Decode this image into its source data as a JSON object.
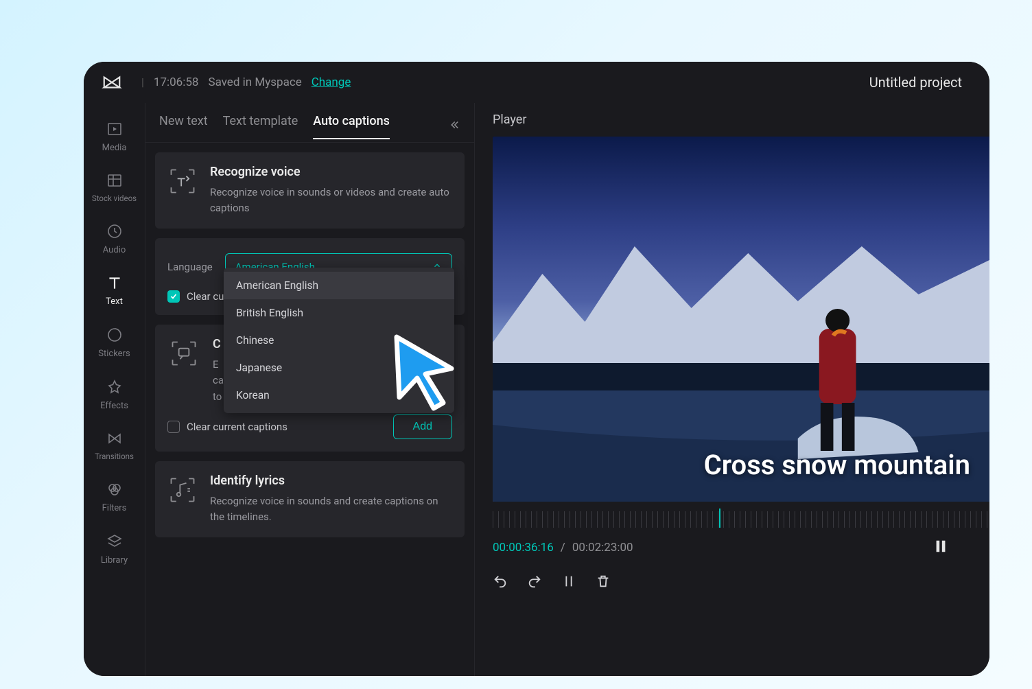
{
  "colors": {
    "accent": "#00c6b7",
    "bg_dark": "#1a1a1e",
    "card": "#26262b",
    "dropdown": "#2e2e33"
  },
  "header": {
    "time": "17:06:58",
    "saved_label": "Saved in Myspace",
    "change_label": "Change",
    "project_title": "Untitled project"
  },
  "sidebar": {
    "items": [
      {
        "icon": "media-icon",
        "label": "Media"
      },
      {
        "icon": "stock-icon",
        "label": "Stock videos"
      },
      {
        "icon": "audio-icon",
        "label": "Audio"
      },
      {
        "icon": "text-icon",
        "label": "Text",
        "active": true
      },
      {
        "icon": "stickers-icon",
        "label": "Stickers"
      },
      {
        "icon": "effects-icon",
        "label": "Effects"
      },
      {
        "icon": "transitions-icon",
        "label": "Transitions"
      },
      {
        "icon": "filters-icon",
        "label": "Filters"
      },
      {
        "icon": "library-icon",
        "label": "Library"
      }
    ]
  },
  "tabs": {
    "items": [
      "New text",
      "Text template",
      "Auto captions"
    ],
    "active_index": 2
  },
  "recognize_card": {
    "title": "Recognize voice",
    "desc": "Recognize voice in sounds or videos and create auto captions",
    "language_label": "Language",
    "selected_language": "American English",
    "options": [
      "American English",
      "British English",
      "Chinese",
      "Japanese",
      "Korean"
    ],
    "clear_checkbox_label_trunc": "Clear cur",
    "clear_checked": true
  },
  "create_card": {
    "title_initial": "C",
    "desc_prefix_lines": [
      "E",
      "ca",
      "to"
    ],
    "clear_label": "Clear current captions",
    "clear_checked": false,
    "add_label": "Add"
  },
  "lyrics_card": {
    "title": "Identify lyrics",
    "desc": "Recognize voice in sounds and create captions on the timelines."
  },
  "player": {
    "title": "Player",
    "caption_overlay": "Cross snow mountain",
    "current_time": "00:00:36:16",
    "duration": "00:02:23:00",
    "separator": "/"
  }
}
